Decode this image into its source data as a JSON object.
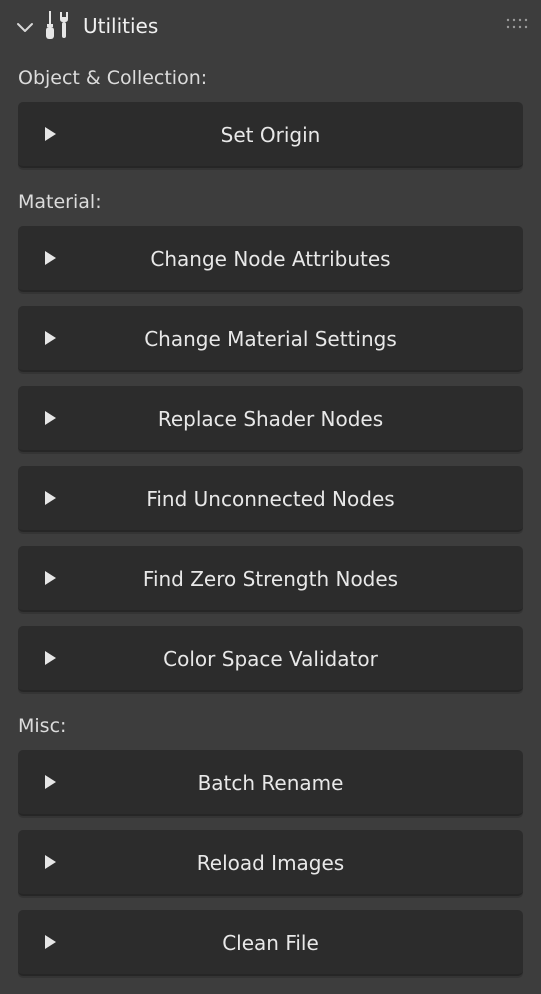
{
  "panel": {
    "title": "Utilities",
    "icons": {
      "collapse": "chevron-down-icon",
      "tools": "screwdriver-wrench-icon",
      "drag": "drag-handle-icon"
    }
  },
  "sections": {
    "object": {
      "label": "Object & Collection:"
    },
    "material": {
      "label": "Material:"
    },
    "misc": {
      "label": "Misc:"
    }
  },
  "buttons": {
    "set_origin": "Set Origin",
    "change_node_attributes": "Change Node Attributes",
    "change_material_settings": "Change Material Settings",
    "replace_shader_nodes": "Replace Shader Nodes",
    "find_unconnected_nodes": "Find Unconnected Nodes",
    "find_zero_strength_nodes": "Find Zero Strength Nodes",
    "color_space_validator": "Color Space Validator",
    "batch_rename": "Batch Rename",
    "reload_images": "Reload Images",
    "clean_file": "Clean File"
  },
  "colors": {
    "panel_bg": "#3d3d3d",
    "button_bg": "#2c2c2c",
    "text": "#e8e8e8"
  }
}
